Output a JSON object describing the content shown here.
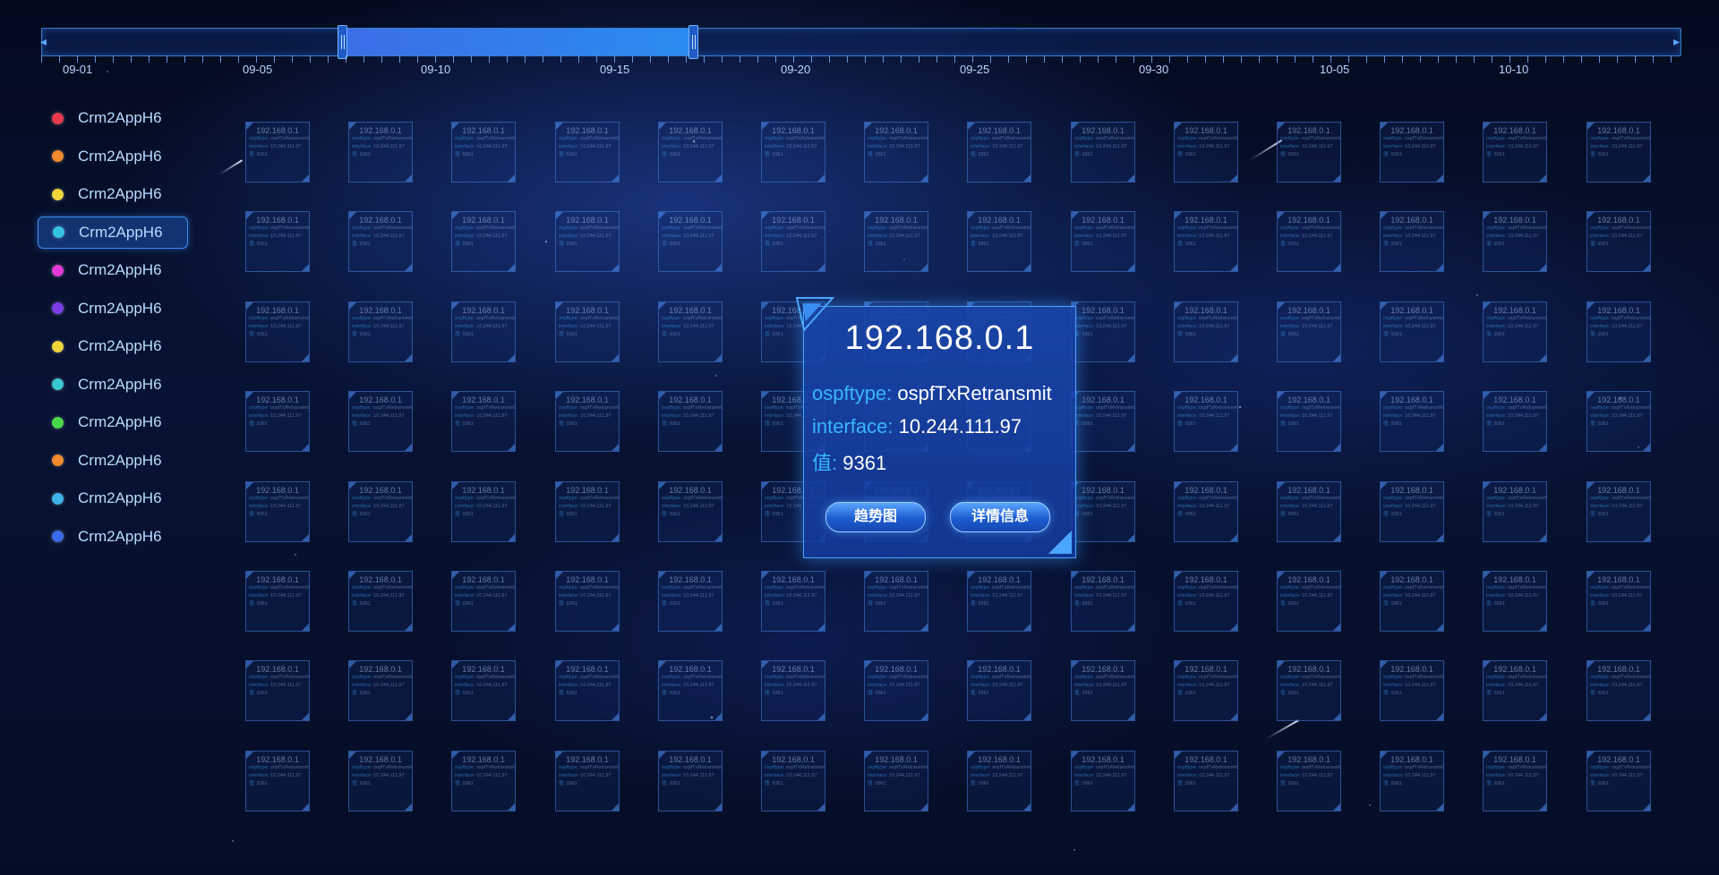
{
  "timeline": {
    "labels": [
      "09-01",
      "09-05",
      "09-10",
      "09-15",
      "09-20",
      "09-25",
      "09-30",
      "10-05",
      "10-10"
    ],
    "selected_start_fraction": 0.18,
    "selected_end_fraction": 0.394
  },
  "legend": {
    "items": [
      {
        "label": "Crm2AppH6",
        "color": "#e8374a"
      },
      {
        "label": "Crm2AppH6",
        "color": "#f08a2c"
      },
      {
        "label": "Crm2AppH6",
        "color": "#f0d43a"
      },
      {
        "label": "Crm2AppH6",
        "color": "#36c3e6",
        "active": true
      },
      {
        "label": "Crm2AppH6",
        "color": "#e23ad6"
      },
      {
        "label": "Crm2AppH6",
        "color": "#7c3ce8"
      },
      {
        "label": "Crm2AppH6",
        "color": "#f0d43a"
      },
      {
        "label": "Crm2AppH6",
        "color": "#3ac8d0"
      },
      {
        "label": "Crm2AppH6",
        "color": "#4ad84a"
      },
      {
        "label": "Crm2AppH6",
        "color": "#f08a2c"
      },
      {
        "label": "Crm2AppH6",
        "color": "#3fb3ea"
      },
      {
        "label": "Crm2AppH6",
        "color": "#3a6ae8"
      }
    ]
  },
  "card": {
    "ip": "192.168.0.1",
    "ospftype_key": "ospftype:",
    "ospftype_value": "ospfTxRetransmit",
    "interface_key": "interface:",
    "interface_value": "10.244.111.97",
    "value_key": "值:",
    "value": "9361"
  },
  "popup": {
    "title": "192.168.0.1",
    "ospftype_key": "ospftype:",
    "ospftype_value": "ospfTxRetransmit",
    "interface_key": "interface:",
    "interface_value": "10.244.111.97",
    "value_key": "值:",
    "value": "9361",
    "trend_button": "趋势图",
    "detail_button": "详情信息"
  },
  "colors": {
    "accent": "#39b6ff",
    "panel_border": "#4aa2ff",
    "selected_range": "#3b6ee8"
  }
}
